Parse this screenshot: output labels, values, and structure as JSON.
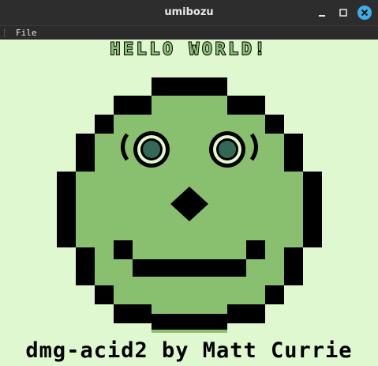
{
  "window": {
    "title": "umibozu"
  },
  "menu": {
    "file_label": "File"
  },
  "screen": {
    "banner_text": "HELLO WORLD!",
    "footer_text": "dmg-acid2 by Matt Currie",
    "colors": {
      "lightest": "#e0f8d0",
      "light": "#88c070",
      "dark": "#346856",
      "darkest": "#081820"
    }
  },
  "icons": {
    "minimize": "minimize-icon",
    "maximize": "maximize-icon",
    "close": "close-icon"
  }
}
